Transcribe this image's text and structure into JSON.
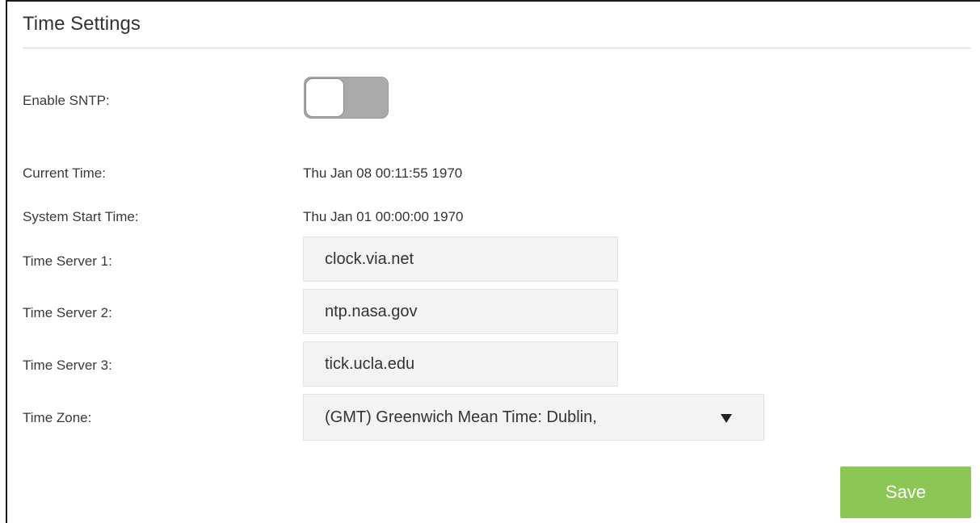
{
  "section": {
    "title": "Time Settings"
  },
  "sntp": {
    "label": "Enable SNTP:",
    "enabled": false
  },
  "current_time": {
    "label": "Current Time:",
    "value": "Thu Jan 08 00:11:55 1970"
  },
  "system_start_time": {
    "label": "System Start Time:",
    "value": "Thu Jan 01 00:00:00 1970"
  },
  "time_server_1": {
    "label": "Time Server 1:",
    "value": "clock.via.net"
  },
  "time_server_2": {
    "label": "Time Server 2:",
    "value": "ntp.nasa.gov"
  },
  "time_server_3": {
    "label": "Time Server 3:",
    "value": "tick.ucla.edu"
  },
  "time_zone": {
    "label": "Time Zone:",
    "selected": "(GMT) Greenwich Mean Time: Dublin,",
    "arrow_icon": "triangle-down-icon"
  },
  "actions": {
    "save_label": "Save"
  },
  "colors": {
    "save_button": "#8cc756",
    "toggle_off": "#a9a9a9",
    "field_background": "#f3f3f3"
  }
}
